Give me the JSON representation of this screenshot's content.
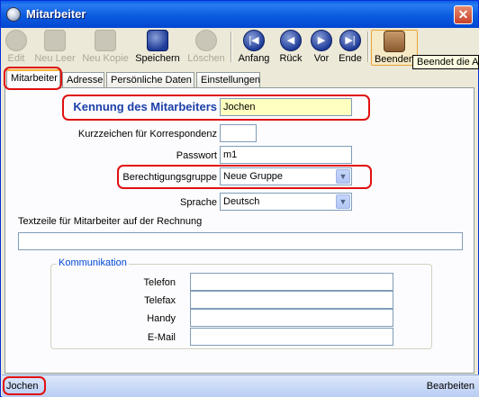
{
  "window": {
    "title": "Mitarbeiter",
    "close_glyph": "✕"
  },
  "toolbar": {
    "buttons": [
      {
        "label": "Edit",
        "icon": "edit-icon",
        "state": "disabled"
      },
      {
        "label": "Neu Leer",
        "icon": "new-blank-icon",
        "state": "disabled"
      },
      {
        "label": "Neu Kopie",
        "icon": "new-copy-icon",
        "state": "disabled"
      },
      {
        "label": "Speichern",
        "icon": "save-icon",
        "state": "enabled"
      },
      {
        "label": "Löschen",
        "icon": "trash-icon",
        "state": "disabled"
      },
      {
        "label": "Anfang",
        "icon": "first-record-icon",
        "state": "enabled"
      },
      {
        "label": "Rück",
        "icon": "previous-record-icon",
        "state": "enabled"
      },
      {
        "label": "Vor",
        "icon": "next-record-icon",
        "state": "enabled"
      },
      {
        "label": "Ende",
        "icon": "last-record-icon",
        "state": "enabled"
      },
      {
        "label": "Beenden",
        "icon": "exit-door-icon",
        "state": "hover"
      }
    ],
    "tooltip": "Beendet die Ar"
  },
  "tabs": [
    {
      "label": "Mitarbeiter",
      "selected": true
    },
    {
      "label": "Adresse",
      "selected": false
    },
    {
      "label": "Persönliche Daten",
      "selected": false
    },
    {
      "label": "Einstellungen",
      "selected": false
    }
  ],
  "form": {
    "kennung_label": "Kennung des Mitarbeiters",
    "kennung_value": "Jochen",
    "kurzzeichen_label": "Kurzzeichen für Korrespondenz",
    "kurzzeichen_value": "",
    "passwort_label": "Passwort",
    "passwort_value": "m1",
    "berechtigung_label": "Berechtigungsgruppe",
    "berechtigung_value": "Neue Gruppe",
    "sprache_label": "Sprache",
    "sprache_value": "Deutsch",
    "textzeile_label": "Textzeile für Mitarbeiter auf der Rechnung",
    "textzeile_value": ""
  },
  "kommunikation": {
    "title": "Kommunikation",
    "telefon_label": "Telefon",
    "telefax_label": "Telefax",
    "handy_label": "Handy",
    "email_label": "E-Mail",
    "telefon_value": "",
    "telefax_value": "",
    "handy_value": "",
    "email_value": ""
  },
  "status": {
    "left": "Jochen",
    "right": "Bearbeiten"
  },
  "colors": {
    "highlight": "#e01010",
    "titlebar": "#0b5ce0",
    "kennung_label": "#1b3fa8"
  }
}
